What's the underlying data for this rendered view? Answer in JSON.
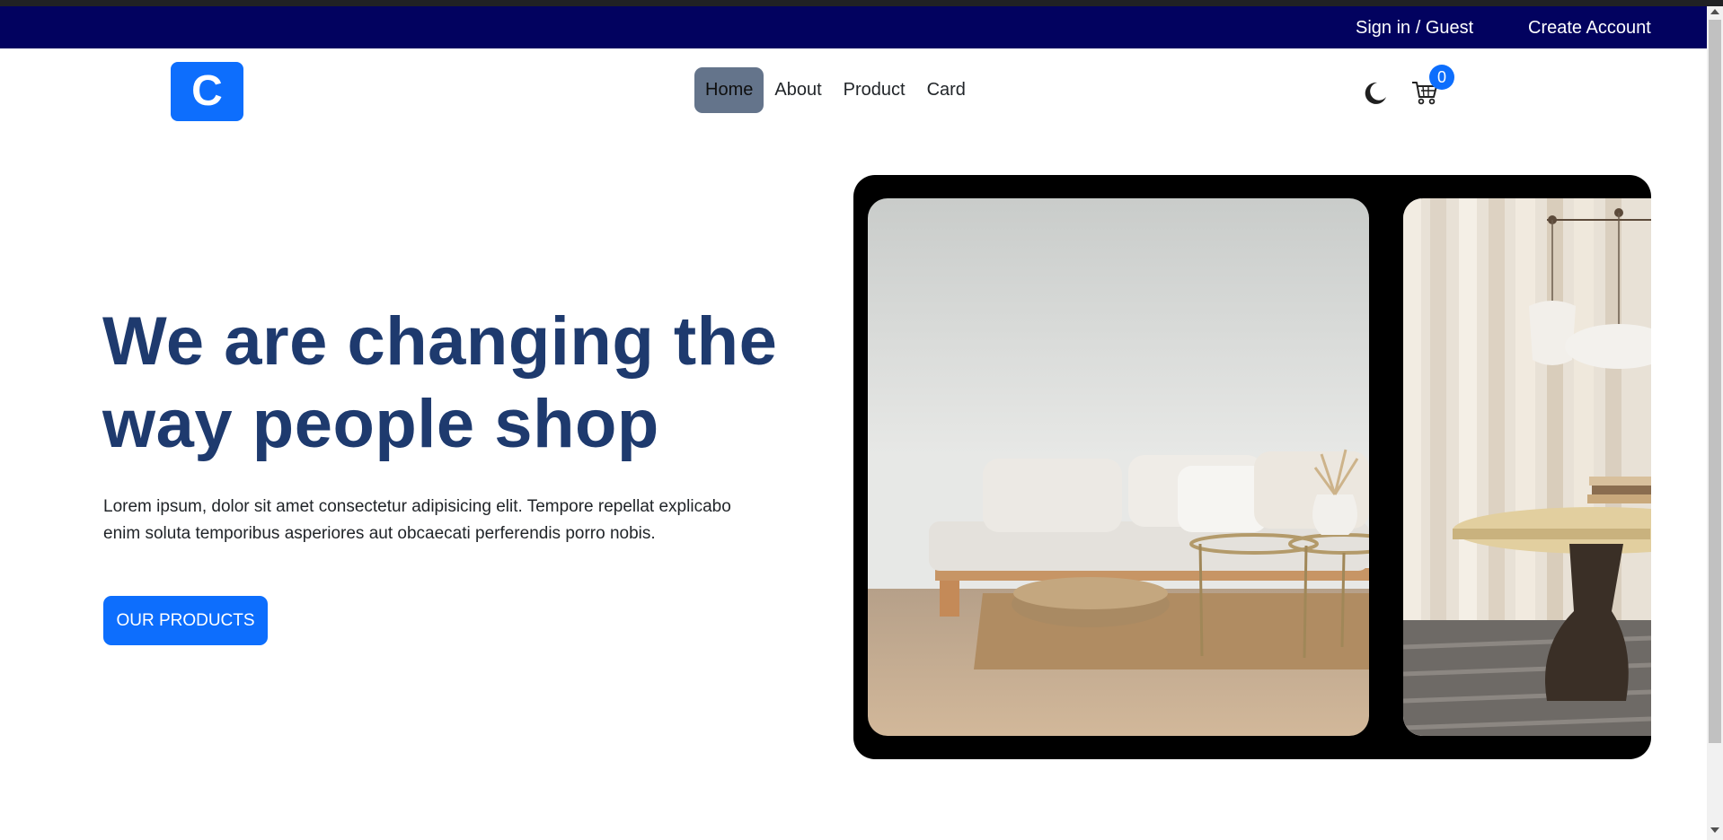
{
  "topbar": {
    "signin_label": "Sign in / Guest",
    "create_account_label": "Create Account",
    "background": "#02025f"
  },
  "logo": {
    "letter": "C",
    "color": "#0d6efd"
  },
  "nav": {
    "items": [
      {
        "label": "Home",
        "active": true
      },
      {
        "label": "About"
      },
      {
        "label": "Product"
      },
      {
        "label": "Card"
      }
    ]
  },
  "actions": {
    "theme_icon": "moon-icon",
    "cart_icon": "cart-icon",
    "cart_count": "0"
  },
  "hero": {
    "title": "We are changing the way people shop",
    "text": "Lorem ipsum, dolor sit amet consectetur adipisicing elit. Tempore repellat explicabo enim soluta temporibus asperiores aut obcaecati perferendis porro nobis.",
    "cta_label": "OUR PRODUCTS"
  },
  "carousel": {
    "slides": [
      "living-room-sofa-image",
      "dining-table-lamp-image"
    ]
  },
  "colors": {
    "accent": "#0d6efd",
    "heading": "#1e3a6e",
    "nav_active": "#64748b"
  }
}
